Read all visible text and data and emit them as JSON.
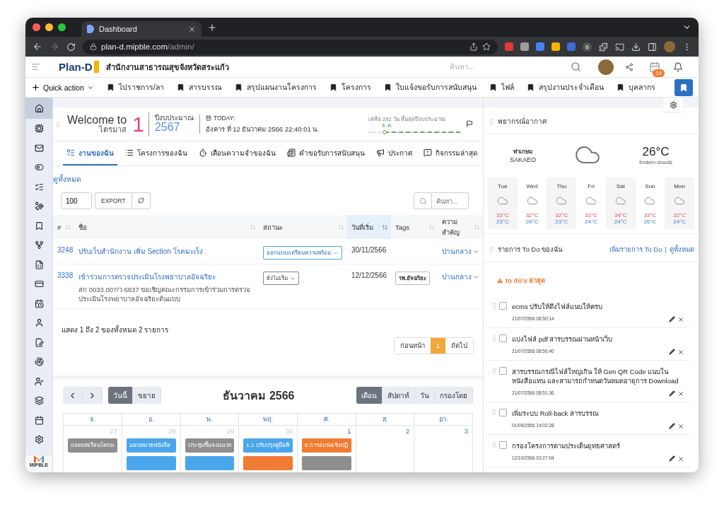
{
  "browser": {
    "tab_title": "Dashboard",
    "url_host": "plan-d.mipble.com",
    "url_path": "/admin/",
    "extension_badge": "6"
  },
  "header": {
    "logo": "Plan-D",
    "org": "สำนักงานสาธารณสุขจังหวัดสระแก้ว",
    "search": {
      "placeholder": "ค้นหา..."
    },
    "badge": "19"
  },
  "quick_bar": {
    "quick_action": "Quick action",
    "bookmarks": [
      "ไปราชการ/ลา",
      "สารบรรณ",
      "สรุปแผนงานโครงการ",
      "โครงการ",
      "ใบแจ้งขอรับการสนับสนุน",
      "ไฟล์",
      "สรุปงานประจำเดือน",
      "บุคลากร"
    ]
  },
  "sidebar": {
    "items": [
      {
        "selected": true
      },
      {
        "selected": false
      },
      {
        "selected": false
      },
      {
        "selected": false
      },
      {
        "selected": false
      },
      {
        "selected": false
      },
      {
        "selected": false
      },
      {
        "selected": false
      },
      {
        "selected": false
      },
      {
        "selected": false
      },
      {
        "selected": false
      },
      {
        "selected": false
      },
      {
        "selected": false
      },
      {
        "selected": false
      },
      {
        "selected": false
      },
      {
        "selected": false
      },
      {
        "selected": false
      },
      {
        "selected": false
      }
    ],
    "logo_text": "MIPBLE"
  },
  "welcome": {
    "greeting": "Welcome to",
    "quarter_label": "ไตรมาส",
    "quarter": "1",
    "fiscal_label": "ปีงบประมาณ",
    "fiscal_year": "2567",
    "today_label": "TODAY:",
    "today": "อังคาร ที่ 12 ธันวาคม 2566 22:40:01 น.",
    "remaining": "เหลือ 292 วัน สิ้นสุดปีงบประมาณ",
    "timeline": {
      "label": "ธ.ค.",
      "level": 0.18
    }
  },
  "tabs": [
    {
      "label": "งานของฉัน",
      "selected": true
    },
    {
      "label": "โครงการของฉัน",
      "selected": false
    },
    {
      "label": "เตือนความจำของฉัน",
      "selected": false
    },
    {
      "label": "คำขอรับการสนับสนุน",
      "selected": false
    },
    {
      "label": "ประกาศ",
      "selected": false
    },
    {
      "label": "กิจกรรมล่าสุด",
      "selected": false
    }
  ],
  "view_all": "ดูทั้งหมด",
  "table_tools": {
    "page_size": "100",
    "export": "EXPORT",
    "search": {
      "placeholder": "ค้นหา..."
    }
  },
  "table": {
    "columns": [
      {
        "label": "#",
        "sorted": false
      },
      {
        "label": "ชื่อ",
        "sorted": false
      },
      {
        "label": "สถานะ",
        "sorted": false
      },
      {
        "label": "วันที่เริ่ม",
        "sorted": true
      },
      {
        "label": "Tags",
        "sorted": false
      },
      {
        "label": "ความสำคัญ",
        "sorted": false
      }
    ],
    "rows": [
      {
        "id": "3248",
        "name": "ปรับเว็บสำนักงาน เพิ่ม Section โรคมะเร็ง",
        "status": "ออกแบบ/เตรียมความพร้อม",
        "kind": "active",
        "start": "30/11/2566",
        "priority": "ปานกลาง"
      },
      {
        "id": "3338",
        "name": "เข้าร่วมการตรวจประเมินโรงพยาบาลอัจฉริยะ",
        "note": "สก 0033.007/ว 6837 ขอเชิญคณะกรรมการเข้าร่วมการตรวจประเมินโรงพยาบาลอัจฉริยะต้นแบบ",
        "status": "ยังไม่เริ่ม",
        "kind": "pending",
        "start": "12/12/2566",
        "tag": "รพ.อัจฉริยะ",
        "priority": "ปานกลาง"
      }
    ],
    "info": "แสดง 1 ถึง 2 ของทั้งหมด 2 รายการ",
    "pagination": [
      {
        "label": "ก่อนหน้า",
        "selected": false
      },
      {
        "label": "1",
        "selected": true
      },
      {
        "label": "ถัดไป",
        "selected": false
      }
    ]
  },
  "calendar": {
    "buttons": [
      {
        "label": "วันนี้",
        "selected": true
      },
      {
        "label": "ขยาย",
        "selected": false
      }
    ],
    "title": "ธันวาคม 2566",
    "views": [
      {
        "label": "เดือน",
        "selected": true
      },
      {
        "label": "สัปดาห์",
        "selected": false
      },
      {
        "label": "วัน",
        "selected": false
      },
      {
        "label": "กรองโดย",
        "selected": false
      }
    ],
    "weekdays": [
      "จ.",
      "อ.",
      "พ.",
      "พฤ.",
      "ศ.",
      "ส.",
      "อา."
    ],
    "days": [
      {
        "day": "27",
        "other_month": true,
        "events": [
          {
            "label": "ถอดบทเรียนโครงเ",
            "color": "#8e8e8e"
          }
        ]
      },
      {
        "day": "28",
        "other_month": true,
        "events": [
          {
            "label": "มอบหมายหนังสือ",
            "color": "#4aa6ea"
          },
          {
            "color": "#4aa6ea"
          }
        ]
      },
      {
        "day": "29",
        "other_month": true,
        "events": [
          {
            "label": "ประชุมชี้แจงแนวท",
            "color": "#8e8e8e"
          },
          {
            "color": "#4aa6ea"
          }
        ]
      },
      {
        "day": "30",
        "other_month": true,
        "events": [
          {
            "label": "1.1 ปรับปรุงคู่มือพิ",
            "color": "#4aa6ea"
          },
          {
            "color": "#f07b32"
          }
        ]
      },
      {
        "day": "1",
        "other_month": false,
        "events": [
          {
            "label": "6.การอบรมเชิงปฏิ",
            "color": "#f07b32"
          },
          {
            "color": "#8e8e8e"
          }
        ]
      },
      {
        "day": "2",
        "other_month": false
      },
      {
        "day": "3",
        "other_month": false
      }
    ]
  },
  "weather": {
    "title": "พยากรณ์อากาศ",
    "place": "ท่าเกษม",
    "city": "SAKAEO",
    "temp": "26°C",
    "desc": "broken clouds",
    "forecast": [
      {
        "day": "Tue",
        "high": "33°C",
        "low": "23°C"
      },
      {
        "day": "Wed",
        "high": "32°C",
        "low": "24°C"
      },
      {
        "day": "Thu",
        "high": "32°C",
        "low": "23°C"
      },
      {
        "day": "Fri",
        "high": "33°C",
        "low": "24°C"
      },
      {
        "day": "Sat",
        "high": "34°C",
        "low": "24°C"
      },
      {
        "day": "Sun",
        "high": "33°C",
        "low": "26°C"
      },
      {
        "day": "Mon",
        "high": "32°C",
        "low": "24°C"
      }
    ]
  },
  "todo": {
    "title": "รายการ To Do ของฉัน",
    "add": "เพิ่มรายการ To Do",
    "separator": "|",
    "view_all": "ดูทั้งหมด",
    "recent": "to do's ล่าสุด",
    "items": [
      {
        "text": "ecms ปรับให้ดึงไฟล์แนบให้ครบ",
        "date": "21/07/2566 08:50:14",
        "checked": false
      },
      {
        "text": "แบ่งไฟล์ pdf สารบรรณผ่านหน้าเว็บ",
        "date": "21/07/2566 08:50:40",
        "checked": false
      },
      {
        "text": "สารบรรณกรณีไฟล์ใหญ่เกิน ให้ Gen QR Code แนบในหนังสือแทน และสามารถกำหนดวันหมดอายุการ Download",
        "date": "21/07/2566 08:51:36",
        "checked": false
      },
      {
        "text": "เพิ่มระบบ Roll-back สารบรรณ",
        "date": "01/09/2566 14:02:28",
        "checked": false
      },
      {
        "text": "กรองโครงการตามประเด็นยุทธศาสตร์",
        "date": "12/10/2566 03:27:04",
        "checked": false
      }
    ]
  }
}
